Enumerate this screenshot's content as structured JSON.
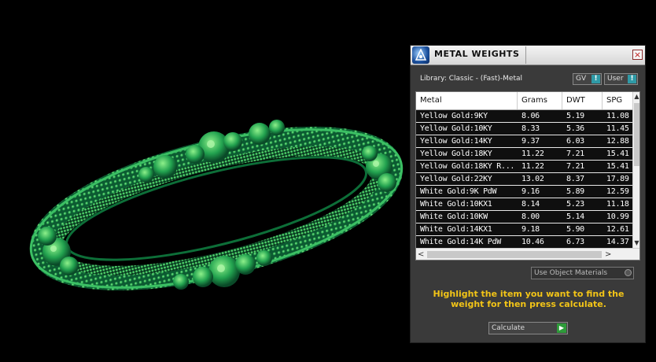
{
  "panel": {
    "title": "METAL WEIGHTS",
    "close_glyph": "×",
    "library_label": "Library: Classic - (Fast)-Metal",
    "gv_label": "GV",
    "user_label": "User",
    "button_glyph": "!",
    "table": {
      "headers": [
        "Metal",
        "Grams",
        "DWT",
        "SPG"
      ],
      "rows": [
        [
          "Yellow Gold:9KY",
          "8.06",
          "5.19",
          "11.08"
        ],
        [
          "Yellow Gold:10KY",
          "8.33",
          "5.36",
          "11.45"
        ],
        [
          "Yellow Gold:14KY",
          "9.37",
          "6.03",
          "12.88"
        ],
        [
          "Yellow Gold:18KY",
          "11.22",
          "7.21",
          "15.41"
        ],
        [
          "Yellow Gold:18KY R...",
          "11.22",
          "7.21",
          "15.41"
        ],
        [
          "Yellow Gold:22KY",
          "13.02",
          "8.37",
          "17.89"
        ],
        [
          "White Gold:9K PdW",
          "9.16",
          "5.89",
          "12.59"
        ],
        [
          "White Gold:10KX1",
          "8.14",
          "5.23",
          "11.18"
        ],
        [
          "White Gold:10KW",
          "8.00",
          "5.14",
          "10.99"
        ],
        [
          "White Gold:14KX1",
          "9.18",
          "5.90",
          "12.61"
        ],
        [
          "White Gold:14K PdW",
          "10.46",
          "6.73",
          "14.37"
        ]
      ]
    },
    "use_object_materials_label": "Use Object Materials",
    "hint": "Highlight the item you want to find the weight for then press calculate.",
    "calculate_label": "Calculate",
    "calculate_glyph": "▶"
  },
  "viewport": {
    "object": "bangle-3d-model",
    "color": "#1fa55a"
  },
  "colors": {
    "accent_yellow": "#f2c417",
    "selected_row": "#0f0f0f",
    "knob": "#2f9aa6"
  },
  "icons": [
    "app-logo-icon",
    "close-icon",
    "chevron-up-icon",
    "chevron-down-icon",
    "chevron-left-icon",
    "chevron-right-icon",
    "play-icon"
  ]
}
